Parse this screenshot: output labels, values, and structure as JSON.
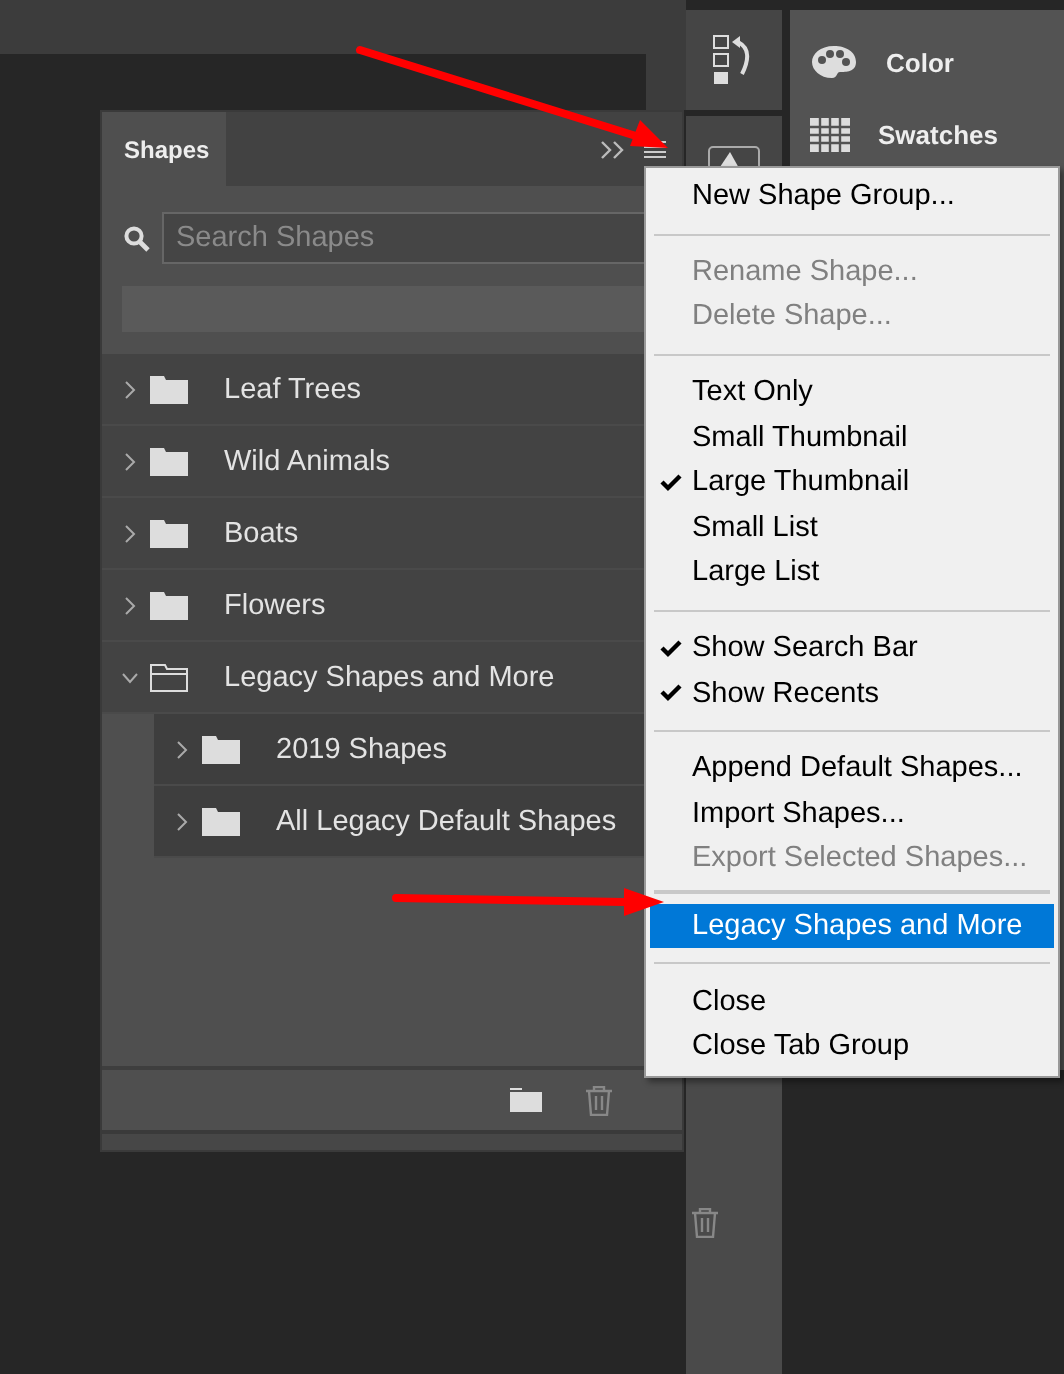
{
  "dock_panels": [
    {
      "label": "Color"
    },
    {
      "label": "Swatches"
    }
  ],
  "shapes_panel": {
    "tab": "Shapes",
    "search": {
      "placeholder": "Search Shapes"
    },
    "tree": [
      {
        "label": "Leaf Trees",
        "expanded": false
      },
      {
        "label": "Wild Animals",
        "expanded": false
      },
      {
        "label": "Boats",
        "expanded": false
      },
      {
        "label": "Flowers",
        "expanded": false
      },
      {
        "label": "Legacy Shapes and More",
        "expanded": true,
        "children": [
          {
            "label": "2019 Shapes",
            "expanded": false
          },
          {
            "label": "All Legacy Default Shapes",
            "expanded": false
          }
        ]
      }
    ]
  },
  "menu": {
    "sections": [
      {
        "items": [
          {
            "label": "New Shape Group...",
            "checked": false,
            "disabled": false,
            "selected": false
          }
        ]
      },
      {
        "items": [
          {
            "label": "Rename Shape...",
            "checked": false,
            "disabled": true,
            "selected": false
          },
          {
            "label": "Delete Shape...",
            "checked": false,
            "disabled": true,
            "selected": false
          }
        ]
      },
      {
        "items": [
          {
            "label": "Text Only",
            "checked": false,
            "disabled": false,
            "selected": false
          },
          {
            "label": "Small Thumbnail",
            "checked": false,
            "disabled": false,
            "selected": false
          },
          {
            "label": "Large Thumbnail",
            "checked": true,
            "disabled": false,
            "selected": false
          },
          {
            "label": "Small List",
            "checked": false,
            "disabled": false,
            "selected": false
          },
          {
            "label": "Large List",
            "checked": false,
            "disabled": false,
            "selected": false
          }
        ]
      },
      {
        "items": [
          {
            "label": "Show Search Bar",
            "checked": true,
            "disabled": false,
            "selected": false
          },
          {
            "label": "Show Recents",
            "checked": true,
            "disabled": false,
            "selected": false
          }
        ]
      },
      {
        "items": [
          {
            "label": "Append Default Shapes...",
            "checked": false,
            "disabled": false,
            "selected": false
          },
          {
            "label": "Import Shapes...",
            "checked": false,
            "disabled": false,
            "selected": false
          },
          {
            "label": "Export Selected Shapes...",
            "checked": false,
            "disabled": true,
            "selected": false
          }
        ]
      },
      {
        "items": [
          {
            "label": "Legacy Shapes and More",
            "checked": false,
            "disabled": false,
            "selected": true
          }
        ]
      },
      {
        "items": [
          {
            "label": "Close",
            "checked": false,
            "disabled": false,
            "selected": false
          },
          {
            "label": "Close Tab Group",
            "checked": false,
            "disabled": false,
            "selected": false
          }
        ]
      }
    ]
  }
}
